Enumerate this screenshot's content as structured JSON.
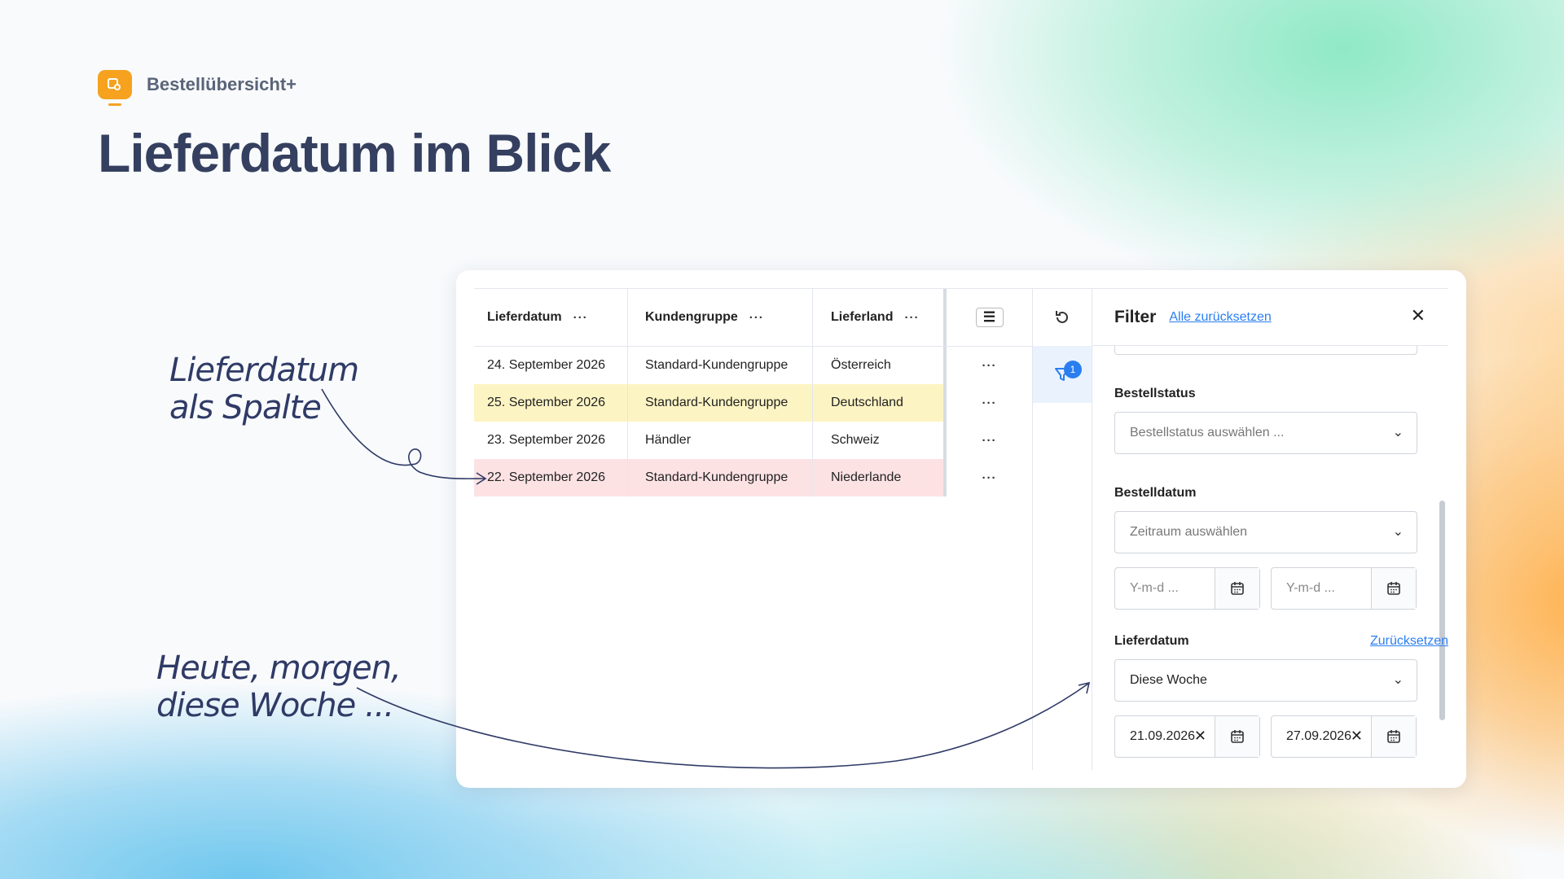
{
  "brand": {
    "name": "Bestellübersicht+"
  },
  "headline": "Lieferdatum im Blick",
  "notes": {
    "column_line1": "Lieferdatum",
    "column_line2": "als Spalte",
    "filter_line1": "Heute, morgen,",
    "filter_line2": "diese Woche ..."
  },
  "table": {
    "headers": [
      "Lieferdatum",
      "Kundengruppe",
      "Lieferland"
    ],
    "header_dots": "···",
    "rows": [
      {
        "date": "24. September 2026",
        "group": "Standard-Kundengruppe",
        "country": "Österreich",
        "highlight": "none"
      },
      {
        "date": "25. September 2026",
        "group": "Standard-Kundengruppe",
        "country": "Deutschland",
        "highlight": "yellow"
      },
      {
        "date": "23. September 2026",
        "group": "Händler",
        "country": "Schweiz",
        "highlight": "none"
      },
      {
        "date": "22. September 2026",
        "group": "Standard-Kundengruppe",
        "country": "Niederlande",
        "highlight": "red"
      }
    ]
  },
  "side": {
    "filter_badge": "1"
  },
  "filter": {
    "title": "Filter",
    "reset_all": "Alle zurücksetzen",
    "bestellstatus": {
      "label": "Bestellstatus",
      "placeholder": "Bestellstatus auswählen ..."
    },
    "bestelldatum": {
      "label": "Bestelldatum",
      "placeholder": "Zeitraum auswählen",
      "from_placeholder": "Y-m-d ...",
      "to_placeholder": "Y-m-d ..."
    },
    "lieferdatum": {
      "label": "Lieferdatum",
      "reset": "Zurücksetzen",
      "value": "Diese Woche",
      "from": "21.09.2026",
      "to": "27.09.2026"
    }
  },
  "colors": {
    "accent": "#2a7ef0",
    "brand": "#f6a21e",
    "headline": "#354060",
    "row_yellow": "#fdf4c3",
    "row_red": "#fde2e4"
  }
}
